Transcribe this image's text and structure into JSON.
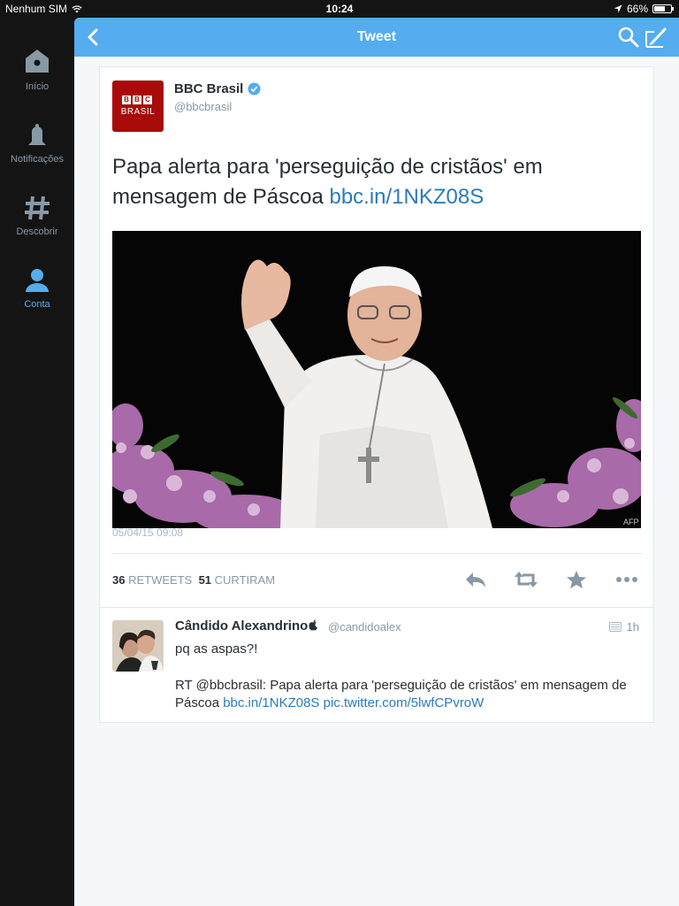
{
  "status_bar": {
    "carrier": "Nenhum SIM",
    "time": "10:24",
    "battery": "66%",
    "battery_level": 0.66
  },
  "sidebar": {
    "items": [
      {
        "label": "Início",
        "icon": "home-icon",
        "active": false
      },
      {
        "label": "Notificações",
        "icon": "bell-icon",
        "active": false
      },
      {
        "label": "Descobrir",
        "icon": "hashtag-icon",
        "active": false
      },
      {
        "label": "Conta",
        "icon": "person-icon",
        "active": true
      }
    ]
  },
  "navbar": {
    "title": "Tweet",
    "back_icon": "chevron-left-icon",
    "search_icon": "search-icon",
    "compose_icon": "compose-icon"
  },
  "tweet": {
    "author_name": "BBC Brasil",
    "author_handle": "@bbcbrasil",
    "avatar_text_top": [
      "B",
      "B",
      "C"
    ],
    "avatar_text_bottom": "BRASIL",
    "text": "Papa alerta para 'perseguição de cristãos' em mensagem de Páscoa ",
    "link": "bbc.in/1NKZ08S",
    "image_credit": "AFP",
    "timestamp": "05/04/15 09:08",
    "retweets_count": "36",
    "retweets_label": "RETWEETS",
    "likes_count": "51",
    "likes_label": "CURTIRAM"
  },
  "reply": {
    "name": "Cândido Alexandrino",
    "handle": "@candidoalex",
    "time": "1h",
    "line1": "pq as aspas?!",
    "line2_text": "RT @bbcbrasil: Papa alerta para 'perseguição de cristãos' em mensagem de Páscoa ",
    "line2_link1": "bbc.in/1NKZ08S",
    "line2_link2": "pic.twitter.com/5lwfCPvroW"
  },
  "colors": {
    "accent": "#55acee",
    "link": "#2b7bb9",
    "sidebar_bg": "#141414",
    "muted": "#8899a6"
  }
}
